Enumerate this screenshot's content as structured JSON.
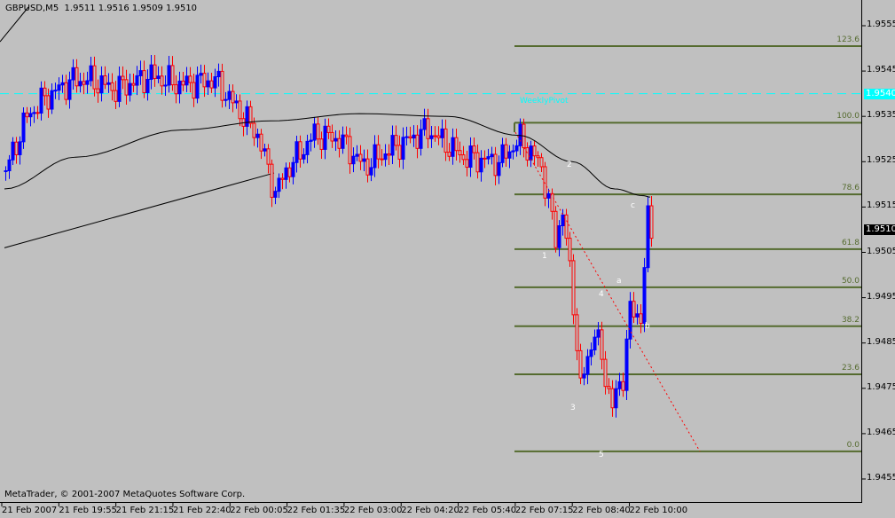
{
  "header": {
    "symbol": "GBPUSD,M5",
    "ohlc": "1.9511 1.9516 1.9509 1.9510"
  },
  "copyright": "MetaTrader, © 2001-2007 MetaQuotes Software Corp.",
  "colors": {
    "background": "#c0c0c0",
    "bull": "#0000ff",
    "bear": "#ff0000",
    "fib": "#556b2f",
    "pivot": "#00ffff",
    "ma": "#000000"
  },
  "pivot": {
    "label": "WeeklyPivot",
    "price": 1.954,
    "tag": "1.9540"
  },
  "current_price": {
    "price": 1.951,
    "tag": "1.9510"
  },
  "y_axis": {
    "labels": [
      "1.9555",
      "1.9545",
      "1.9535",
      "1.9525",
      "1.9515",
      "1.9505",
      "1.9495",
      "1.9485",
      "1.9475",
      "1.9465",
      "1.9455"
    ],
    "values": [
      1.9555,
      1.9545,
      1.9535,
      1.9525,
      1.9515,
      1.9505,
      1.9495,
      1.9485,
      1.9475,
      1.9465,
      1.9455
    ]
  },
  "x_axis": {
    "labels": [
      "21 Feb 2007",
      "21 Feb 19:55",
      "21 Feb 21:15",
      "21 Feb 22:40",
      "22 Feb 00:05",
      "22 Feb 01:35",
      "22 Feb 03:00",
      "22 Feb 04:20",
      "22 Feb 05:40",
      "22 Feb 07:15",
      "22 Feb 08:40",
      "22 Feb 10:00"
    ],
    "bar_index": [
      0,
      16,
      32,
      48,
      64,
      80,
      96,
      112,
      128,
      144,
      160,
      176
    ]
  },
  "fibonacci": {
    "levels": [
      {
        "label": "123.6",
        "price": 1.95505
      },
      {
        "label": "100.0",
        "price": 1.95336
      },
      {
        "label": "78.6",
        "price": 1.95178
      },
      {
        "label": "61.8",
        "price": 1.95057
      },
      {
        "label": "50.0",
        "price": 1.94973
      },
      {
        "label": "38.2",
        "price": 1.94887
      },
      {
        "label": "23.6",
        "price": 1.94781
      },
      {
        "label": "0.0",
        "price": 1.94611
      }
    ],
    "start_bar": 144
  },
  "waves": [
    {
      "label": "1",
      "bar": 152,
      "price": 1.9504
    },
    {
      "label": "2",
      "bar": 159,
      "price": 1.9524
    },
    {
      "label": "3",
      "bar": 160,
      "price": 1.94705
    },
    {
      "label": "4",
      "bar": 168,
      "price": 1.94955
    },
    {
      "label": "5",
      "bar": 168,
      "price": 1.946
    },
    {
      "label": "a",
      "bar": 173,
      "price": 1.94985
    },
    {
      "label": "b",
      "bar": 181,
      "price": 1.94885
    },
    {
      "label": "c",
      "bar": 177,
      "price": 1.9515
    }
  ],
  "chart_data": {
    "type": "candlestick",
    "symbol": "GBPUSD",
    "timeframe": "M5",
    "ylim": [
      1.945,
      1.9562
    ],
    "close_waypoints": [
      [
        0,
        1.9523
      ],
      [
        6,
        1.9535
      ],
      [
        11,
        1.9539
      ],
      [
        19,
        1.9543
      ],
      [
        24,
        1.9543
      ],
      [
        31,
        1.9541
      ],
      [
        41,
        1.9544
      ],
      [
        49,
        1.9542
      ],
      [
        59,
        1.9543
      ],
      [
        64,
        1.9538
      ],
      [
        71,
        1.9531
      ],
      [
        76,
        1.9518
      ],
      [
        79,
        1.9523
      ],
      [
        87,
        1.9531
      ],
      [
        94,
        1.953
      ],
      [
        101,
        1.9524
      ],
      [
        109,
        1.9528
      ],
      [
        119,
        1.9532
      ],
      [
        129,
        1.9526
      ],
      [
        139,
        1.9525
      ],
      [
        145,
        1.953
      ],
      [
        151,
        1.9524
      ],
      [
        155,
        1.9508
      ],
      [
        157,
        1.9514
      ],
      [
        160,
        1.9494
      ],
      [
        162,
        1.9475
      ],
      [
        166,
        1.9488
      ],
      [
        171,
        1.9471
      ],
      [
        174,
        1.9478
      ],
      [
        176,
        1.9492
      ],
      [
        179,
        1.9491
      ],
      [
        181,
        1.9512
      ],
      [
        182,
        1.951
      ]
    ],
    "moving_average": [
      [
        0,
        1.9519
      ],
      [
        20,
        1.9526
      ],
      [
        50,
        1.9532
      ],
      [
        75,
        1.9534
      ],
      [
        100,
        1.95356
      ],
      [
        125,
        1.9535
      ],
      [
        145,
        1.95308
      ],
      [
        160,
        1.9525
      ],
      [
        172,
        1.9519
      ],
      [
        180,
        1.95175
      ],
      [
        182,
        1.95172
      ]
    ],
    "trendline": [
      [
        0,
        1.9506
      ],
      [
        76,
        1.95225
      ]
    ],
    "wave_trendline": [
      [
        144,
        1.95315
      ],
      [
        196,
        1.94611
      ]
    ]
  }
}
